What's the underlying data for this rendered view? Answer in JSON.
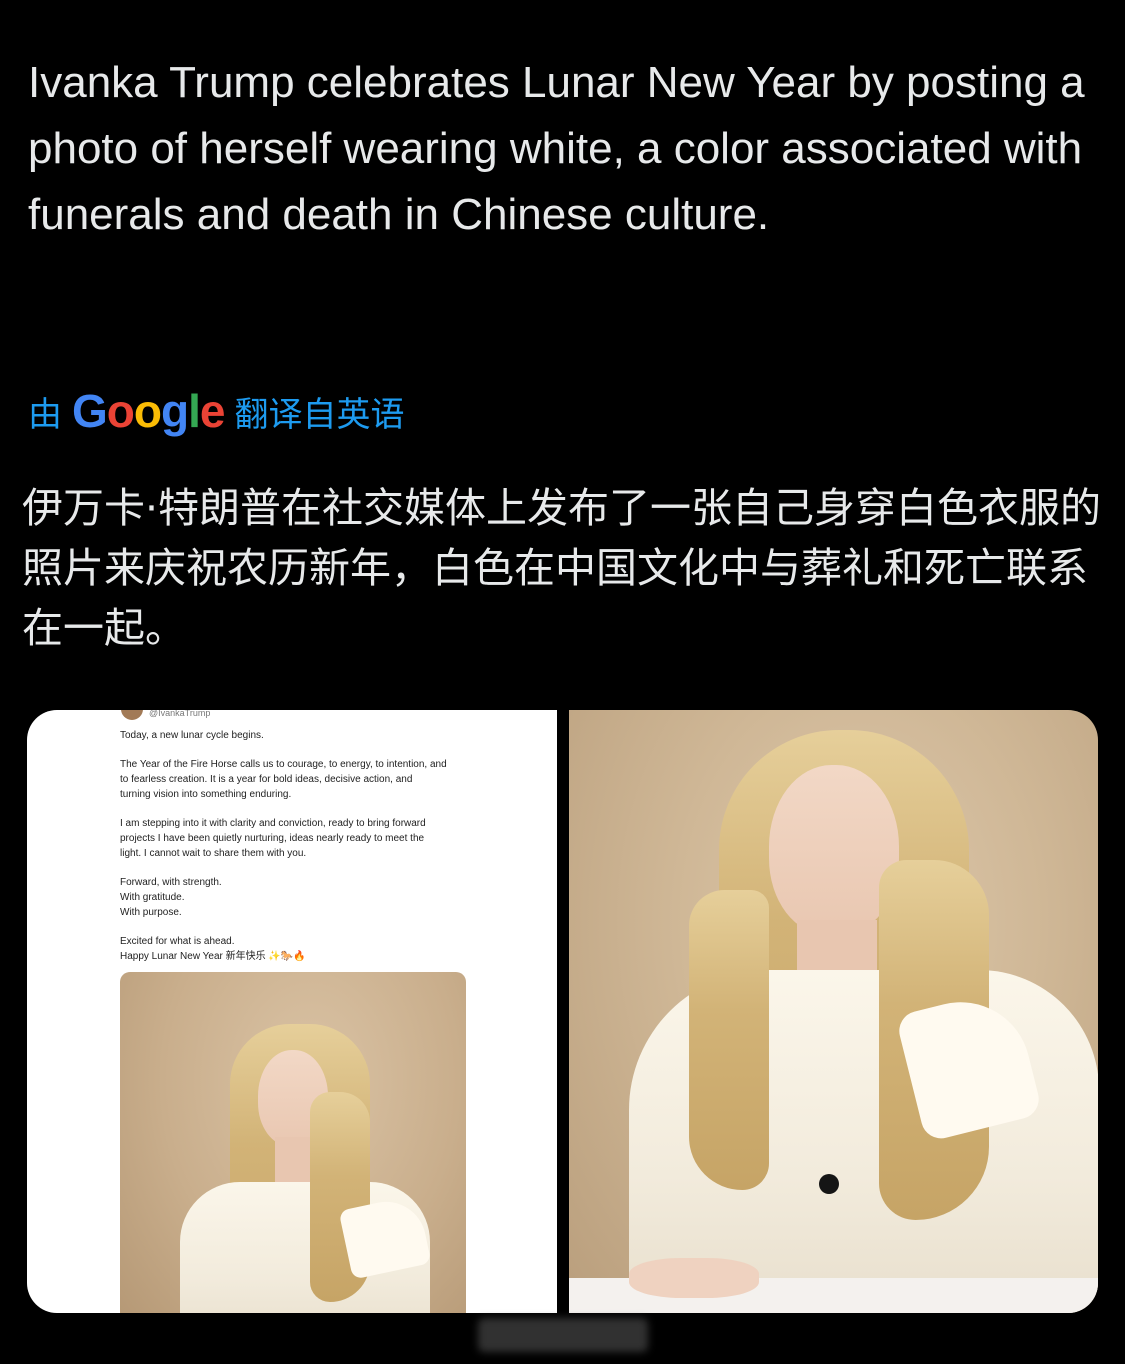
{
  "tweet": {
    "text": "Ivanka Trump celebrates Lunar New Year by posting a photo of herself wearing white, a color associated with funerals and death in Chinese culture.",
    "translation_prefix": "由",
    "translation_suffix": "翻译自英语",
    "translated_text": "伊万卡·特朗普在社交媒体上发布了一张自己身穿白色衣服的照片来庆祝农历新年，白色在中国文化中与葬礼和死亡联系在一起。"
  },
  "embedded_post": {
    "handle": "@IvankaTrump",
    "paragraphs": [
      "Today, a new lunar cycle begins.",
      "The Year of the Fire Horse calls us to courage, to energy, to intention, and\nto fearless creation. It is a year for bold ideas, decisive action, and\nturning vision into something enduring.",
      "I am stepping into it with clarity and conviction, ready to bring forward\nprojects I have been quietly nurturing, ideas nearly ready to meet the\nlight. I cannot wait to share them with you.",
      "Forward, with strength.\nWith gratitude.\nWith purpose.",
      "Excited for what is ahead.\nHappy Lunar New Year 新年快乐 ✨🐎🔥"
    ]
  },
  "colors": {
    "background": "#000000",
    "text": "#e7e9ea",
    "link": "#1d9bf0"
  }
}
